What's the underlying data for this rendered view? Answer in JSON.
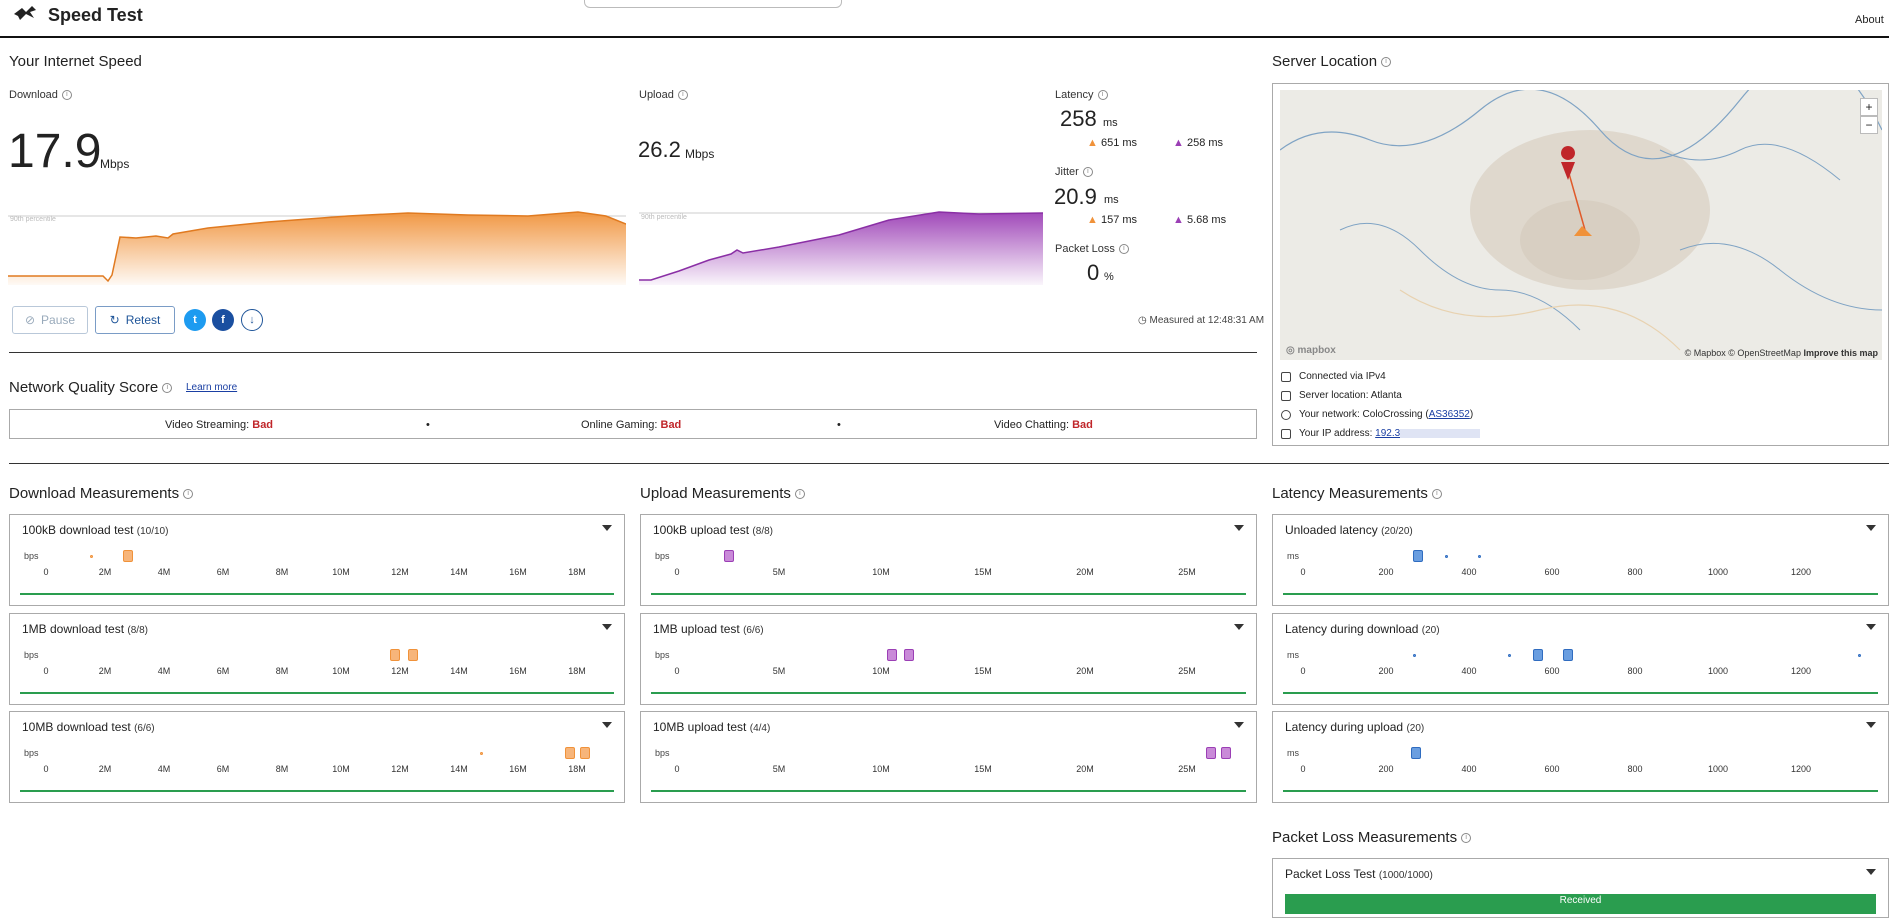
{
  "app": {
    "title": "Speed Test",
    "about": "About"
  },
  "speed": {
    "section_title": "Your Internet Speed",
    "download": {
      "label": "Download",
      "value": "17.9",
      "unit": "Mbps",
      "percentile": "90th percentile"
    },
    "upload": {
      "label": "Upload",
      "value": "26.2",
      "unit": "Mbps",
      "percentile": "90th percentile"
    },
    "latency": {
      "label": "Latency",
      "value": "258",
      "unit": "ms",
      "down": "651 ms",
      "up": "258 ms"
    },
    "jitter": {
      "label": "Jitter",
      "value": "20.9",
      "unit": "ms",
      "down": "157 ms",
      "up": "5.68 ms"
    },
    "packet_loss": {
      "label": "Packet Loss",
      "value": "0",
      "unit": "%"
    },
    "pause": "Pause",
    "retest": "Retest",
    "measured_at": "Measured at 12:48:31 AM"
  },
  "server": {
    "section_title": "Server Location",
    "map_attrib": "© Mapbox © OpenStreetMap",
    "improve": "Improve this map",
    "mapbox_logo": "mapbox",
    "zoom_in": "+",
    "zoom_out": "−",
    "connected": "Connected via IPv4",
    "location": "Server location: Atlanta",
    "network_prefix": "Your network: ColoCrossing (",
    "network_asn": "AS36352",
    "network_suffix": ")",
    "ip_prefix": "Your IP address: ",
    "ip_value": "192.3"
  },
  "nq": {
    "title": "Network Quality Score",
    "learn_more": "Learn more",
    "streaming_label": "Video Streaming:",
    "streaming_value": "Bad",
    "gaming_label": "Online Gaming:",
    "gaming_value": "Bad",
    "chatting_label": "Video Chatting:",
    "chatting_value": "Bad",
    "dot": "•"
  },
  "download_measurements": {
    "title": "Download Measurements",
    "unit": "bps",
    "ticks": [
      "0",
      "2M",
      "4M",
      "6M",
      "8M",
      "10M",
      "12M",
      "14M",
      "16M",
      "18M"
    ],
    "tests": [
      {
        "label": "100kB download test",
        "count": "(10/10)"
      },
      {
        "label": "1MB download test",
        "count": "(8/8)"
      },
      {
        "label": "10MB download test",
        "count": "(6/6)"
      }
    ]
  },
  "upload_measurements": {
    "title": "Upload Measurements",
    "unit": "bps",
    "ticks": [
      "0",
      "5M",
      "10M",
      "15M",
      "20M",
      "25M"
    ],
    "tests": [
      {
        "label": "100kB upload test",
        "count": "(8/8)"
      },
      {
        "label": "1MB upload test",
        "count": "(6/6)"
      },
      {
        "label": "10MB upload test",
        "count": "(4/4)"
      }
    ]
  },
  "latency_measurements": {
    "title": "Latency Measurements",
    "unit": "ms",
    "ticks": [
      "0",
      "200",
      "400",
      "600",
      "800",
      "1000",
      "1200"
    ],
    "tests": [
      {
        "label": "Unloaded latency",
        "count": "(20/20)"
      },
      {
        "label": "Latency during download",
        "count": "(20)"
      },
      {
        "label": "Latency during upload",
        "count": "(20)"
      }
    ]
  },
  "packet_loss_measurements": {
    "title": "Packet Loss Measurements",
    "test_label": "Packet Loss Test",
    "test_count": "(1000/1000)",
    "received": "Received"
  },
  "colors": {
    "download": "#f0923a",
    "upload": "#9b3fb5",
    "latency": "#2f6cc0",
    "good": "#2a9d4f",
    "bad": "#c0262a"
  }
}
